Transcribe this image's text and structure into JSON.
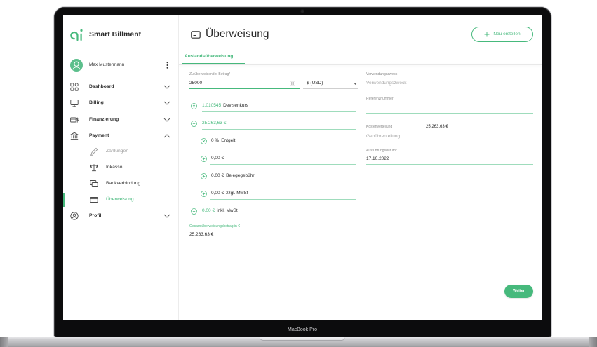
{
  "device": {
    "label": "MacBook Pro"
  },
  "app": {
    "name": "Smart Billment",
    "logo_icon": "smart-billment-logo-icon"
  },
  "user": {
    "name": "Max Mustermann",
    "avatar_icon": "user-avatar-icon",
    "menu_icon": "kebab-menu-icon"
  },
  "nav": {
    "items": [
      {
        "label": "Dashboard",
        "icon": "dashboard-icon",
        "expanded": false
      },
      {
        "label": "Billing",
        "icon": "monitor-icon",
        "expanded": false
      },
      {
        "label": "Finanzierung",
        "icon": "card-dollar-icon",
        "expanded": false
      },
      {
        "label": "Payment",
        "icon": "bank-icon",
        "expanded": true,
        "children": [
          {
            "label": "Zahlungen",
            "icon": "pen-icon",
            "disabled": true
          },
          {
            "label": "Inkasso",
            "icon": "scale-icon"
          },
          {
            "label": "Bankverbindung",
            "icon": "cards-icon"
          },
          {
            "label": "Überweisung",
            "icon": "card-icon",
            "active": true
          }
        ]
      },
      {
        "label": "Profil",
        "icon": "user-circle-icon",
        "expanded": false
      }
    ]
  },
  "header": {
    "title": "Überweisung",
    "title_icon": "card-icon",
    "new_button": "Neu erstellen",
    "new_button_icon": "plus-icon"
  },
  "tabs": [
    {
      "label": "Auslandsüberweisung",
      "active": true
    }
  ],
  "form": {
    "amount": {
      "label": "Zu überweisender Betrag*",
      "value": "25000",
      "icon": "calculator-icon"
    },
    "currency": {
      "value": "$ (USD)",
      "icon": "dropdown-arrow-icon"
    },
    "exchange_rate": {
      "icon": "times-circle-icon",
      "value": "1.010545",
      "label": "Devisenkurs"
    },
    "converted": {
      "icon": "minus-circle-icon",
      "value": "25.263,63 €"
    },
    "fee": {
      "icon": "times-circle-icon",
      "value": "0 %",
      "label": "Entgelt"
    },
    "fee_amount": {
      "icon": "plus-circle-icon",
      "value": "0,00 €"
    },
    "receipt_fee": {
      "icon": "plus-circle-icon",
      "value": "0,00 €",
      "label": "Belegegebühr"
    },
    "plus_vat": {
      "icon": "plus-circle-icon",
      "value": "0,00 €",
      "label": "zzgl. MwSt"
    },
    "incl_vat": {
      "icon": "plus-circle-icon",
      "value": "0,00 €",
      "label": "inkl. MwSt"
    },
    "total": {
      "label": "Gesamtüberweisungsbetrag in €",
      "value": "25.263,63 €"
    },
    "purpose": {
      "label": "Verwendungszweck",
      "placeholder": "Verwendungszweck"
    },
    "reference": {
      "label": "Referenznummer"
    },
    "cost_split": {
      "label": "Kostenverteilung",
      "amount": "25.263,63 €",
      "placeholder": "Gebührenteilung"
    },
    "execution_date": {
      "label": "Ausführungsdatum*",
      "value": "17.10.2022"
    }
  },
  "actions": {
    "next": "Weiter"
  },
  "colors": {
    "accent": "#46b97c",
    "accent_light": "#9fdcbc",
    "text": "#2a2a2a",
    "muted": "#a6a6a6",
    "bezel": "#0c0c0d"
  }
}
